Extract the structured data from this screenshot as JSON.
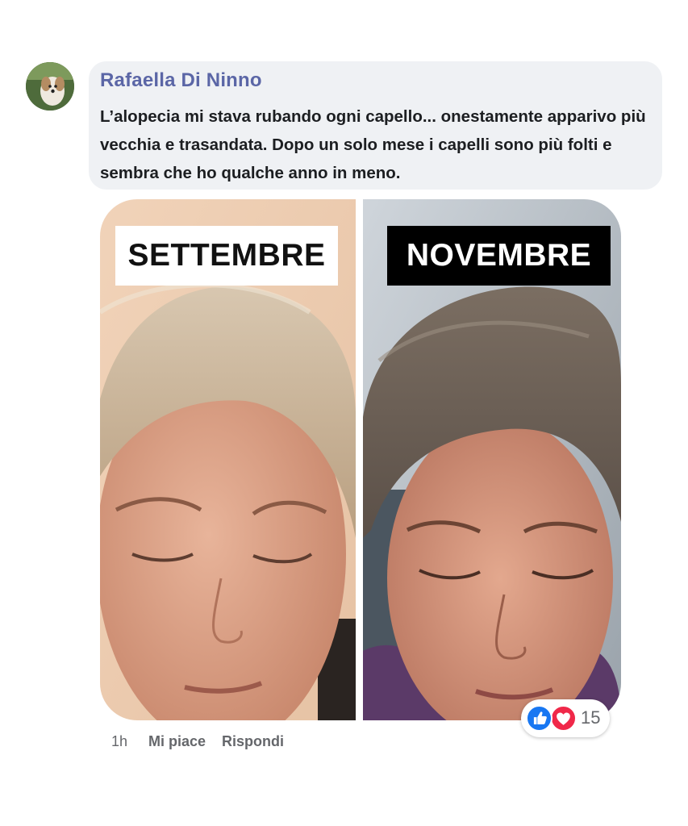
{
  "comment": {
    "author": "Rafaella Di Ninno",
    "text": "L’alopecia mi stava rubando ogni capello... onestamente apparivo più vecchia e trasandata. Dopo un solo mese i capelli sono più folti e sembra che ho qualche anno in meno."
  },
  "image": {
    "before_label": "SETTEMBRE",
    "after_label": "NOVEMBRE"
  },
  "reactions": {
    "icons": [
      "like-icon",
      "love-icon"
    ],
    "count": "15",
    "like_color": "#1877f2",
    "love_color": "#f02849"
  },
  "actions": {
    "time": "1h",
    "like": "Mi piace",
    "reply": "Rispondi"
  }
}
